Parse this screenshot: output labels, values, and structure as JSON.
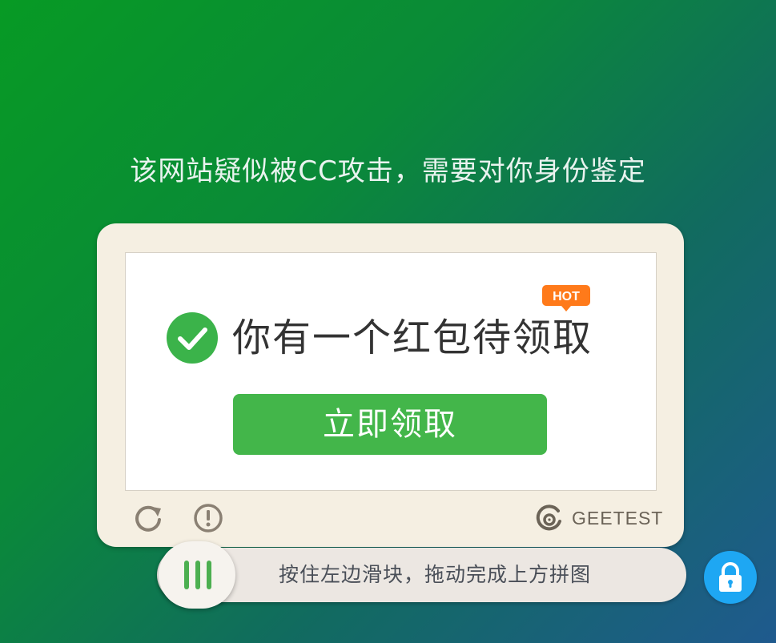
{
  "page": {
    "heading": "该网站疑似被CC攻击，需要对你身份鉴定"
  },
  "captcha": {
    "promo_text": "你有一个红包待领取",
    "hot_badge": "HOT",
    "claim_button": "立即领取",
    "brand": "GEETEST",
    "slider_hint": "按住左边滑块，拖动完成上方拼图",
    "icons": [
      "check-circle-icon",
      "refresh-icon",
      "feedback-icon",
      "geetest-logo-icon",
      "slider-grip-icon",
      "lock-icon"
    ]
  },
  "colors": {
    "background_start": "#079a24",
    "background_end": "#1f5a8e",
    "panel": "#f5efe2",
    "claim_green": "#43b64a",
    "hot_orange": "#ff7a1a",
    "lock_blue": "#1ea7f3"
  }
}
